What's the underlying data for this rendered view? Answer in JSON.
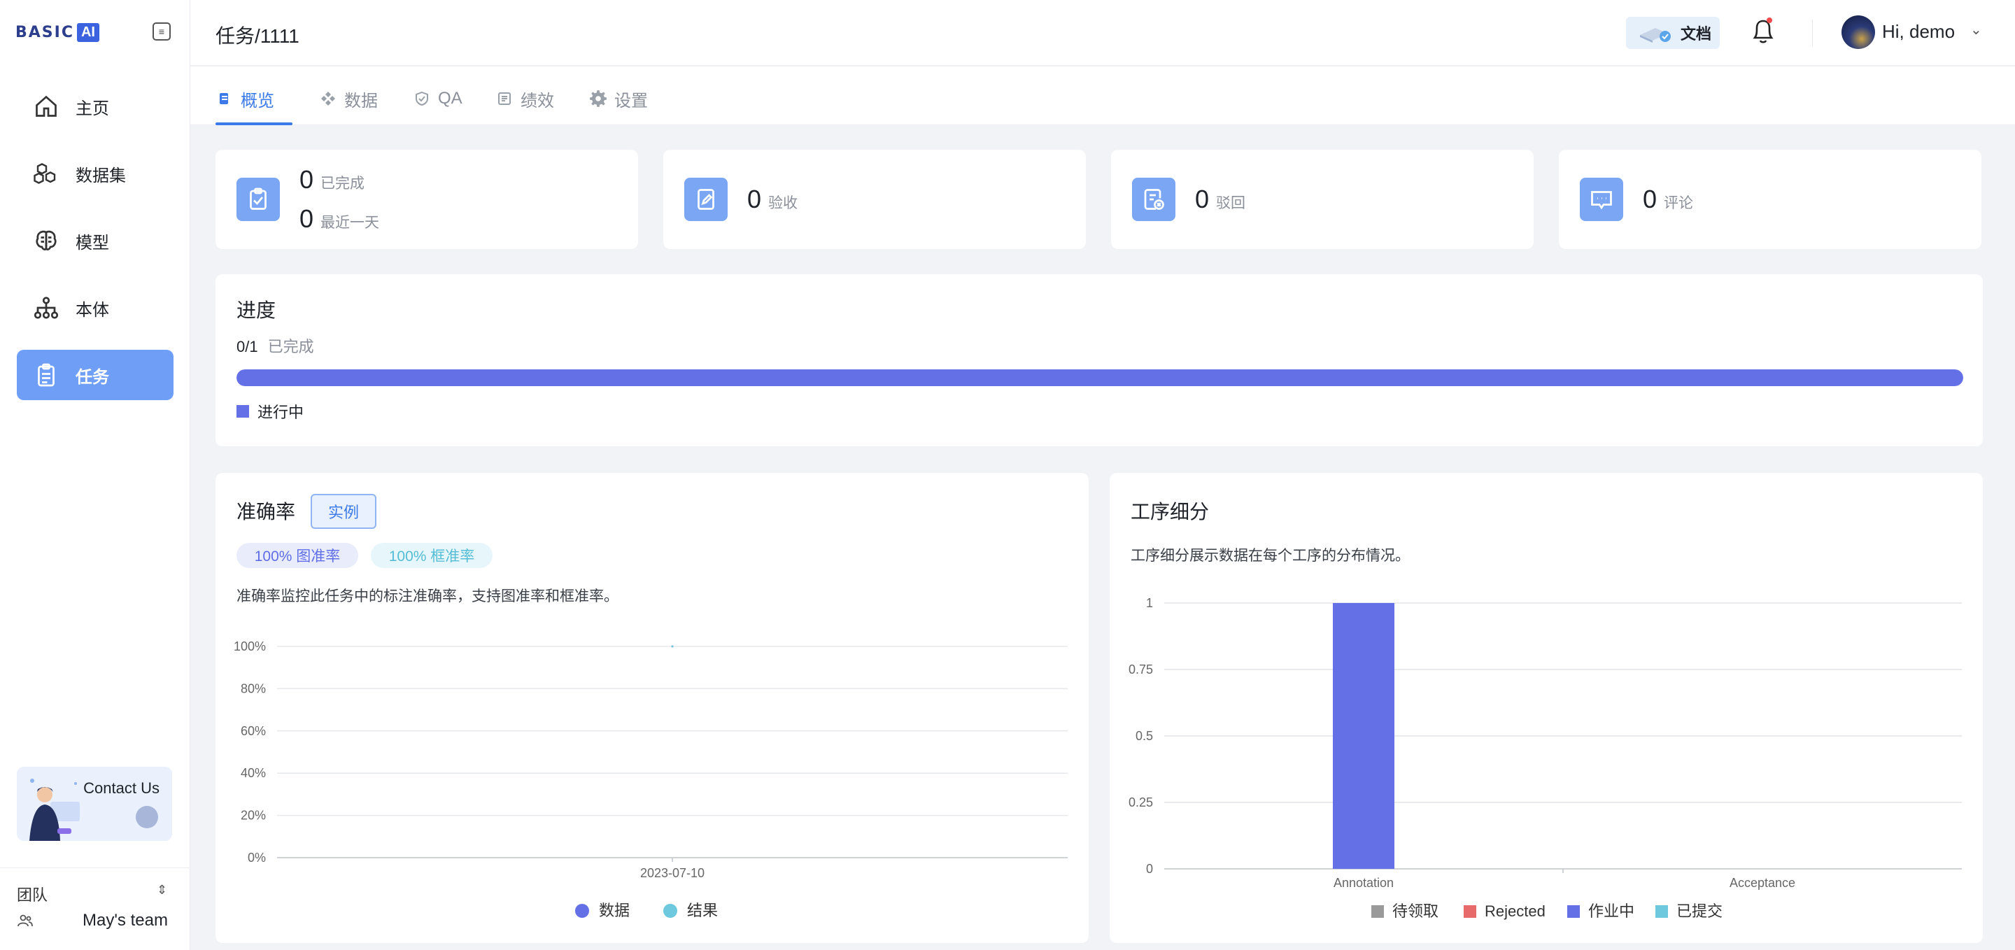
{
  "app": {
    "logo_text": "BASIC",
    "logo_accent": "AI",
    "brand_color": "#3b7ae8"
  },
  "sidebar": {
    "items": [
      {
        "label": "主页",
        "icon": "home-icon"
      },
      {
        "label": "数据集",
        "icon": "cubes-icon"
      },
      {
        "label": "模型",
        "icon": "brain-icon"
      },
      {
        "label": "本体",
        "icon": "hierarchy-icon"
      },
      {
        "label": "任务",
        "icon": "clipboard-icon",
        "active": true
      }
    ],
    "contact_label": "Contact Us",
    "team_label": "团队",
    "team_name": "May's team"
  },
  "header": {
    "breadcrumb": "任务/1111",
    "docs_label": "文档",
    "greeting": "Hi, demo"
  },
  "tabs": [
    {
      "label": "概览",
      "icon": "overview-icon",
      "active": true
    },
    {
      "label": "数据",
      "icon": "data-icon"
    },
    {
      "label": "QA",
      "icon": "shield-check-icon"
    },
    {
      "label": "绩效",
      "icon": "performance-icon"
    },
    {
      "label": "设置",
      "icon": "gear-icon"
    }
  ],
  "stats": {
    "completed_value": "0",
    "completed_label": "已完成",
    "last_day_value": "0",
    "last_day_label": "最近一天",
    "accepted_value": "0",
    "accepted_label": "验收",
    "rejected_value": "0",
    "rejected_label": "驳回",
    "comments_value": "0",
    "comments_label": "评论"
  },
  "progress": {
    "title": "进度",
    "done_text": "0/1",
    "done_label": "已完成",
    "fill_fraction": 1.0,
    "legend_label": "进行中",
    "legend_color": "#6470e6"
  },
  "accuracy": {
    "title": "准确率",
    "example_button": "实例",
    "image_accuracy": "100% 图准率",
    "box_accuracy": "100% 框准率",
    "description": "准确率监控此任务中的标注准确率，支持图准率和框准率。"
  },
  "workflow": {
    "title": "工序细分",
    "description": "工序细分展示数据在每个工序的分布情况。"
  },
  "chart_data": [
    {
      "type": "line",
      "x": [
        "2023-07-10"
      ],
      "y_tick_labels": [
        "100%",
        "80%",
        "60%",
        "40%",
        "20%",
        "0%"
      ],
      "ylim": [
        0,
        100
      ],
      "series": [
        {
          "name": "数据",
          "values": [
            100
          ],
          "color": "#6470e6"
        },
        {
          "name": "结果",
          "values": [
            100
          ],
          "color": "#6ec9df"
        }
      ],
      "legend": "bottom-center",
      "grid": true
    },
    {
      "type": "bar",
      "categories": [
        "Annotation",
        "Acceptance"
      ],
      "y_tick_labels": [
        "1",
        "0.75",
        "0.5",
        "0.25",
        "0"
      ],
      "ylim": [
        0,
        1
      ],
      "series": [
        {
          "name": "待领取",
          "values": [
            0,
            0
          ],
          "color": "#9a9a9a"
        },
        {
          "name": "Rejected",
          "values": [
            0,
            0
          ],
          "color": "#e86b6b"
        },
        {
          "name": "作业中",
          "values": [
            1,
            0
          ],
          "color": "#6470e6"
        },
        {
          "name": "已提交",
          "values": [
            0,
            0
          ],
          "color": "#6ec9df"
        }
      ],
      "legend": "bottom-center",
      "grid": true
    }
  ]
}
